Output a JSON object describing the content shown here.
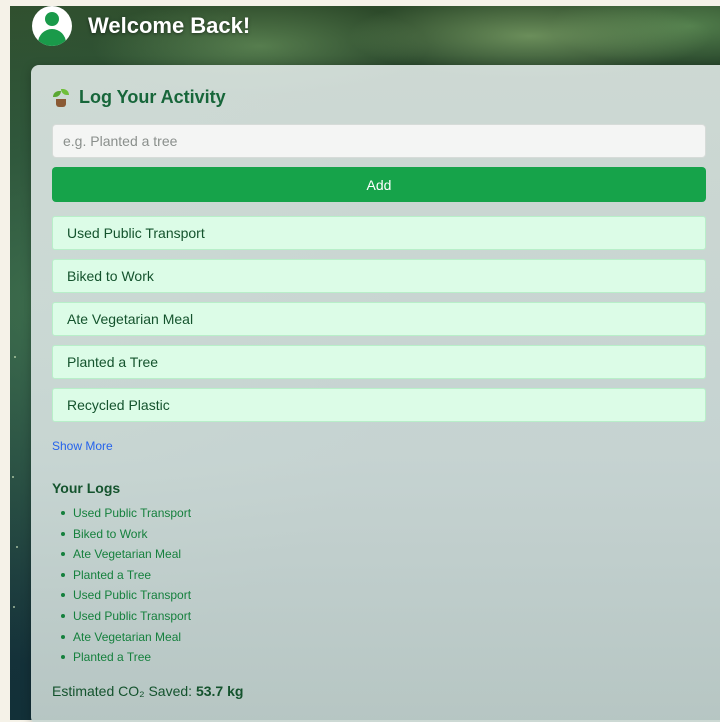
{
  "header": {
    "title": "Welcome Back!",
    "avatar_icon": "user-avatar-icon"
  },
  "card": {
    "title": "Log Your Activity",
    "title_icon": "seedling-icon",
    "input": {
      "placeholder": "e.g. Planted a tree",
      "value": ""
    },
    "add_label": "Add",
    "presets": [
      {
        "label": "Used Public Transport"
      },
      {
        "label": "Biked to Work"
      },
      {
        "label": "Ate Vegetarian Meal"
      },
      {
        "label": "Planted a Tree"
      },
      {
        "label": "Recycled Plastic"
      }
    ],
    "show_more_label": "Show More",
    "logs_title": "Your Logs",
    "logs": [
      "Used Public Transport",
      "Biked to Work",
      "Ate Vegetarian Meal",
      "Planted a Tree",
      "Used Public Transport",
      "Used Public Transport",
      "Ate Vegetarian Meal",
      "Planted a Tree"
    ],
    "co2_label": "Estimated CO₂ Saved:",
    "co2_value": "53.7 kg"
  },
  "colors": {
    "accent": "#16a34a",
    "preset_bg": "#dcfce7",
    "link": "#2563eb",
    "text_dark_green": "#14532d"
  }
}
